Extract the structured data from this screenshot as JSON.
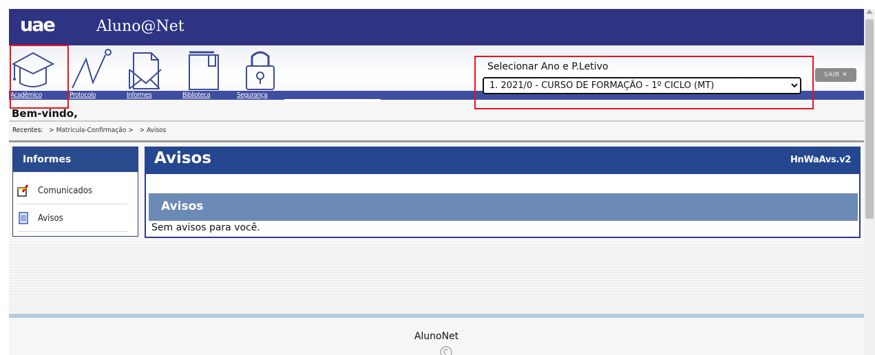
{
  "app": {
    "logo": "uae",
    "title": "Aluno@Net"
  },
  "nav": [
    {
      "label": "Acadêmico",
      "icon": "graduation-cap-icon"
    },
    {
      "label": "Protocolo",
      "icon": "line-chart-icon"
    },
    {
      "label": "Informes",
      "icon": "mail-document-icon"
    },
    {
      "label": "Biblioteca",
      "icon": "book-icon"
    },
    {
      "label": "Segurança",
      "icon": "lock-icon"
    }
  ],
  "year_selector": {
    "label": "Selecionar Ano e P.Letivo",
    "selected": "1. 2021/0 - CURSO DE FORMAÇÃO - 1º CICLO (MT)"
  },
  "logout": {
    "label": "SAIR ✕"
  },
  "welcome": "Bem-vindo,",
  "breadcrumb": {
    "prefix": "Recentes:",
    "items": [
      "> Matricula-Confirmação >",
      "> Avisos"
    ]
  },
  "sidebar": {
    "title": "Informes",
    "items": [
      {
        "label": "Comunicados",
        "icon": "notepad-icon"
      },
      {
        "label": "Avisos",
        "icon": "document-icon"
      }
    ]
  },
  "main": {
    "title": "Avisos",
    "code": "HnWaAvs.v2",
    "section_title": "Avisos",
    "message": "Sem avisos para você."
  },
  "footer": {
    "text": "AlunoNet"
  },
  "colors": {
    "title_bar": "#2e3383",
    "nav_bar": "#3f4ea1",
    "panel_header": "#24478f",
    "section_band": "#6b8ab5",
    "annotation": "#e8141c"
  }
}
